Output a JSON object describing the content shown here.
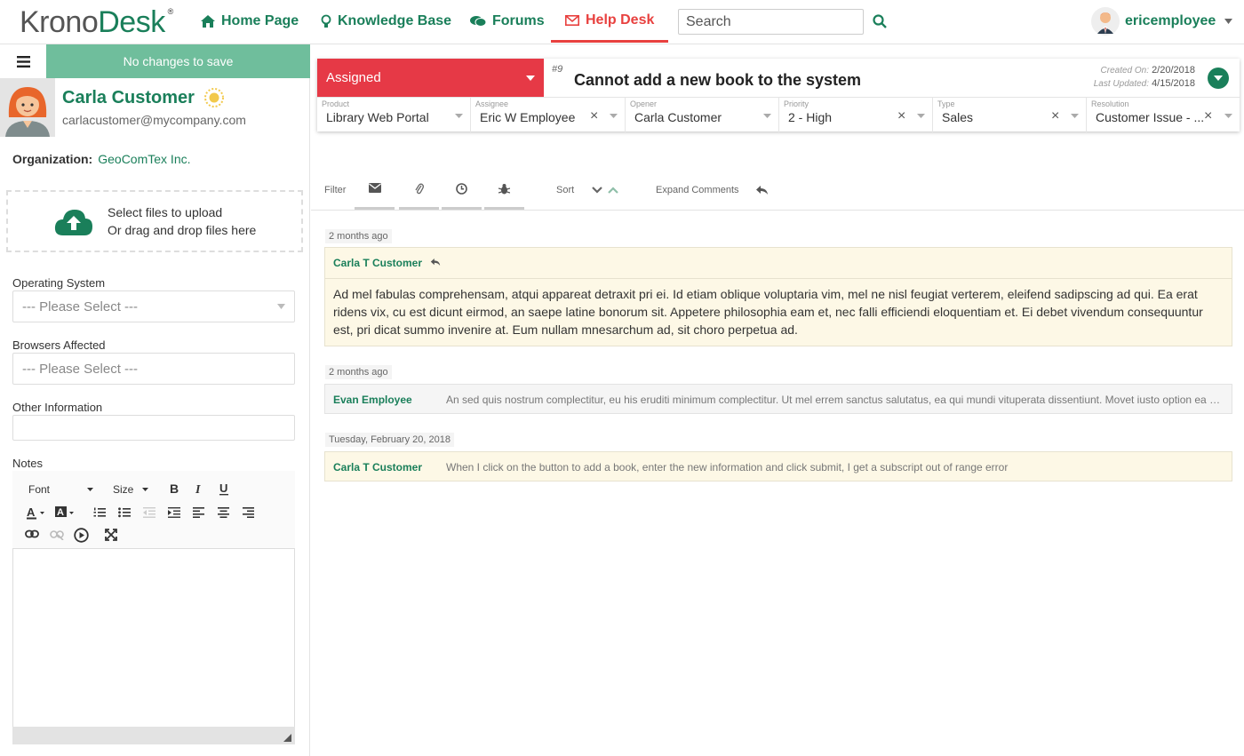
{
  "brand": {
    "part1": "Krono",
    "part2": "Desk",
    "reg": "®"
  },
  "nav": {
    "home": "Home Page",
    "kb": "Knowledge Base",
    "forums": "Forums",
    "helpdesk": "Help Desk",
    "search_placeholder": "Search",
    "user": "ericemployee"
  },
  "left": {
    "save_status": "No changes to save",
    "customer_name": "Carla Customer",
    "customer_email": "carlacustomer@mycompany.com",
    "org_label": "Organization:",
    "org_value": "GeoComTex Inc.",
    "upload_line1": "Select files to upload",
    "upload_line2": "Or drag and drop files here",
    "os_label": "Operating System",
    "os_value": "--- Please Select ---",
    "browsers_label": "Browsers Affected",
    "browsers_value": "--- Please Select ---",
    "other_label": "Other Information",
    "notes_label": "Notes",
    "font_label": "Font",
    "size_label": "Size"
  },
  "ticket": {
    "status": "Assigned",
    "number": "#9",
    "title": "Cannot add a new book to the system",
    "created_label": "Created On:",
    "created": "2/20/2018",
    "updated_label": "Last Updated:",
    "updated": "4/15/2018",
    "fields": [
      {
        "label": "Product",
        "value": "Library Web Portal"
      },
      {
        "label": "Assignee",
        "value": "Eric W Employee"
      },
      {
        "label": "Opener",
        "value": "Carla Customer"
      },
      {
        "label": "Priority",
        "value": "2 - High"
      },
      {
        "label": "Type",
        "value": "Sales"
      },
      {
        "label": "Resolution",
        "value": "Customer Issue - ..."
      }
    ]
  },
  "filterbar": {
    "filter": "Filter",
    "sort": "Sort",
    "expand": "Expand Comments"
  },
  "comments": [
    {
      "ago": "2 months ago",
      "author": "Carla T Customer",
      "body": "Ad mel fabulas comprehensam, atqui appareat detraxit pri ei. Id etiam oblique voluptaria vim, mel ne nisl feugiat verterem, eleifend sadipscing ad qui. Ea erat ridens vix, cu est dicunt eirmod, an saepe latine bonorum sit. Appetere philosophia eam et, nec falli efficiendi eloquentiam et. Ei debet vivendum consequuntur est, pri dicat summo invenire at. Eum nullam mnesarchum ad, sit choro perpetua ad."
    },
    {
      "ago": "2 months ago",
      "author": "Evan Employee",
      "snippet": "An sed quis nostrum complectitur, eu his eruditi minimum complectitur. Ut mel errem sanctus salutatus, ea qui mundi vituperata dissentiunt. Movet iusto option ea est, ..."
    },
    {
      "ago": "Tuesday, February 20, 2018",
      "author": "Carla T Customer",
      "snippet": "When I click on the button to add a book, enter the new information and click submit, I get a subscript out of range error"
    }
  ],
  "colors": {
    "brand_green": "#1a7f5a",
    "status_red": "#e63946",
    "active_red": "#e8413f",
    "save_green": "#6fbe9c"
  }
}
